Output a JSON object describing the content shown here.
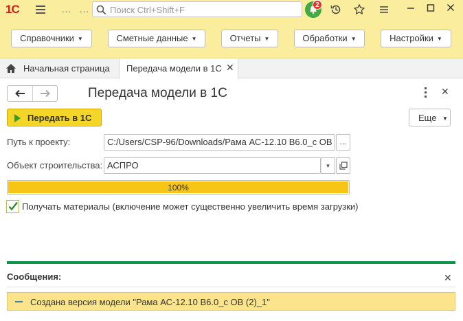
{
  "titlebar": {
    "logo_text": "1С",
    "search_placeholder": "Поиск Ctrl+Shift+F",
    "notification_count": "2",
    "dots": "..."
  },
  "menu": {
    "items": [
      {
        "label": "Справочники"
      },
      {
        "label": "Сметные данные"
      },
      {
        "label": "Отчеты"
      },
      {
        "label": "Обработки"
      },
      {
        "label": "Настройки"
      }
    ]
  },
  "tabs": {
    "home_label": "Начальная страница",
    "active_label": "Передача модели в 1С"
  },
  "form": {
    "title": "Передача модели в 1С",
    "send_button": "Передать в 1С",
    "more_button": "Еще",
    "project_path_label": "Путь к проекту:",
    "project_path_value": "C:/Users/CSP-96/Downloads/Рама АС-12.10 В6.0_с ОВ",
    "project_path_button": "...",
    "object_label": "Объект строительства:",
    "object_value": "АСПРО",
    "progress_text": "100%",
    "progress_value": 100,
    "materials_checked": true,
    "materials_label": "Получать материалы (включение может существенно увеличить время загрузки)"
  },
  "messages": {
    "title": "Сообщения:",
    "items": [
      {
        "text": "Создана версия модели \"Рама АС-12.10 В6.0_с ОВ (2)_1\""
      }
    ]
  },
  "colors": {
    "accent_yellow": "#fbed9e",
    "send_button": "#f3d627",
    "progress_fill": "#f6c515",
    "green_line": "#0e9448",
    "message_bg": "#fbe48c"
  }
}
